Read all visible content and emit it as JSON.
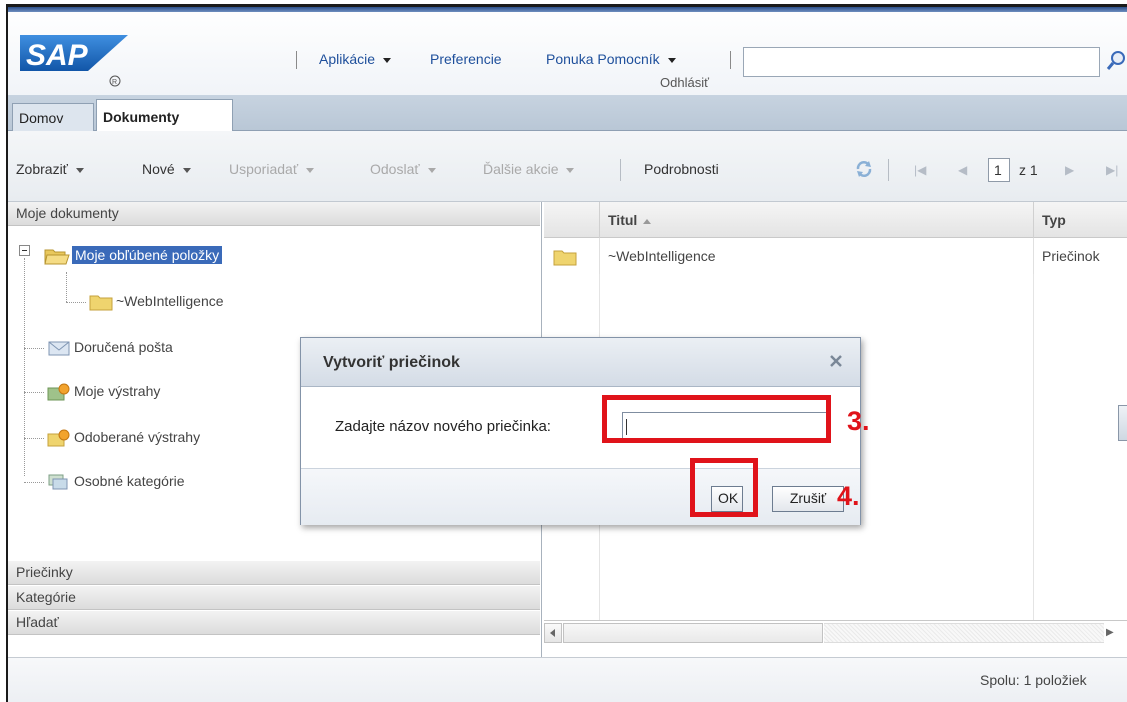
{
  "header": {
    "menu": [
      {
        "label": "Aplikácie",
        "has_caret": true
      },
      {
        "label": "Preferencie",
        "has_caret": false
      },
      {
        "label": "Ponuka Pomocník",
        "has_caret": true
      }
    ],
    "logout": "Odhlásiť",
    "search_value": ""
  },
  "tabs": [
    {
      "label": "Domov",
      "active": false
    },
    {
      "label": "Dokumenty",
      "active": true
    }
  ],
  "toolbar": {
    "zobrazit": "Zobraziť",
    "nove": "Nové",
    "usporiadat": "Usporiadať",
    "odoslat": "Odoslať",
    "dalsie": "Ďalšie akcie",
    "podrobnosti": "Podrobnosti",
    "page_number": "1",
    "page_of": "z 1"
  },
  "left_panel": {
    "moje_dokumenty": "Moje dokumenty",
    "tree": {
      "favorites": "Moje obľúbené položky",
      "webi": "~WebIntelligence",
      "inbox": "Doručená pošta",
      "alerts": "Moje výstrahy",
      "subscribed": "Odoberané výstrahy",
      "categories": "Osobné kategórie"
    },
    "priecinky": "Priečinky",
    "kategorie": "Kategórie",
    "hladat": "Hľadať"
  },
  "grid": {
    "col_titul": "Titul",
    "col_typ": "Typ",
    "rows": [
      {
        "titul": "~WebIntelligence",
        "typ": "Priečinok"
      }
    ]
  },
  "footer": {
    "total": "Spolu: 1 položiek"
  },
  "dialog": {
    "title": "Vytvoriť priečinok",
    "label": "Zadajte názov nového priečinka:",
    "input_value": "",
    "ok": "OK",
    "cancel": "Zrušiť"
  },
  "annotations": {
    "step3": "3.",
    "step4": "4.",
    "color": "#e0131a"
  },
  "colors": {
    "sap_blue": "#1a5fb4",
    "sap_gold": "#e8b000",
    "link": "#1e4f9b",
    "selection": "#3a6ab9"
  }
}
